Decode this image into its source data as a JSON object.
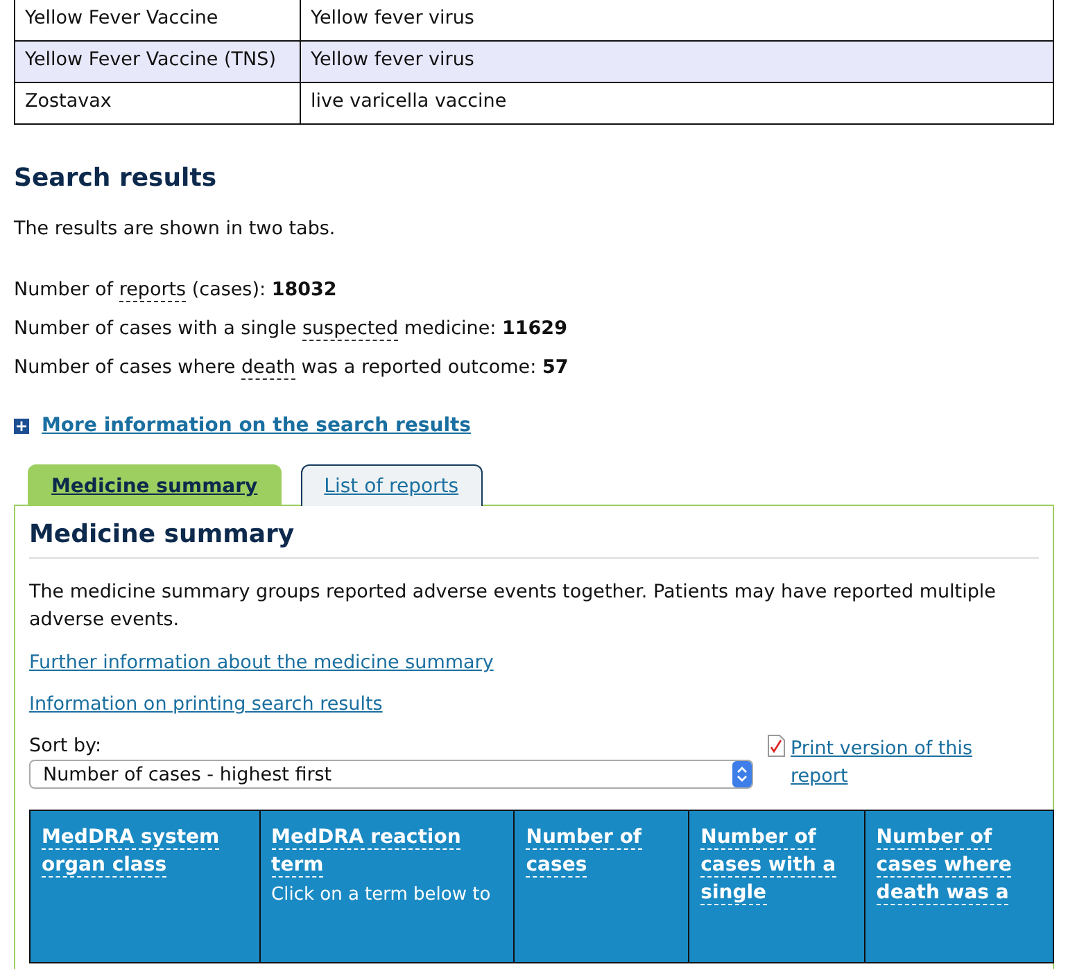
{
  "products_table": {
    "rows": [
      {
        "cells": [
          "Yellow Fever Vaccine",
          "Yellow fever virus"
        ],
        "highlighted": false
      },
      {
        "cells": [
          "Yellow Fever Vaccine (TNS)",
          "Yellow fever virus"
        ],
        "highlighted": true
      },
      {
        "cells": [
          "Zostavax",
          "live varicella vaccine"
        ],
        "highlighted": false
      }
    ]
  },
  "search_results": {
    "title": "Search results",
    "intro": "The results are shown in two tabs.",
    "stats": [
      {
        "before": "Number of ",
        "term": "reports",
        "after": " (cases): ",
        "value": "18032"
      },
      {
        "before": "Number of cases with a single ",
        "term": "suspected",
        "after": " medicine: ",
        "value": "11629"
      },
      {
        "before": "Number of cases where ",
        "term": "death",
        "after": " was a reported outcome: ",
        "value": "57"
      }
    ],
    "more_info": {
      "label": "More information on the search results",
      "expanded": false
    }
  },
  "tabs": [
    {
      "label": "Medicine summary",
      "selected": true
    },
    {
      "label": "List of reports",
      "selected": false
    }
  ],
  "panel": {
    "title": "Medicine summary",
    "description": "The medicine summary groups reported adverse events together. Patients may have reported multiple adverse events.",
    "links": [
      "Further information about the medicine summary",
      "Information on printing search results"
    ],
    "sort": {
      "label": "Sort by:",
      "value": "Number of cases - highest first"
    },
    "print_link": "Print version of this report",
    "summary_table": {
      "columns": [
        {
          "lines": [
            "MedDRA system organ class"
          ]
        },
        {
          "lines": [
            "MedDRA reaction term"
          ],
          "note": "Click on a term below to"
        },
        {
          "lines": [
            "Number of cases"
          ]
        },
        {
          "lines": [
            "Number of cases with a single"
          ]
        },
        {
          "lines": [
            "Number of cases where death was a"
          ]
        }
      ]
    }
  }
}
